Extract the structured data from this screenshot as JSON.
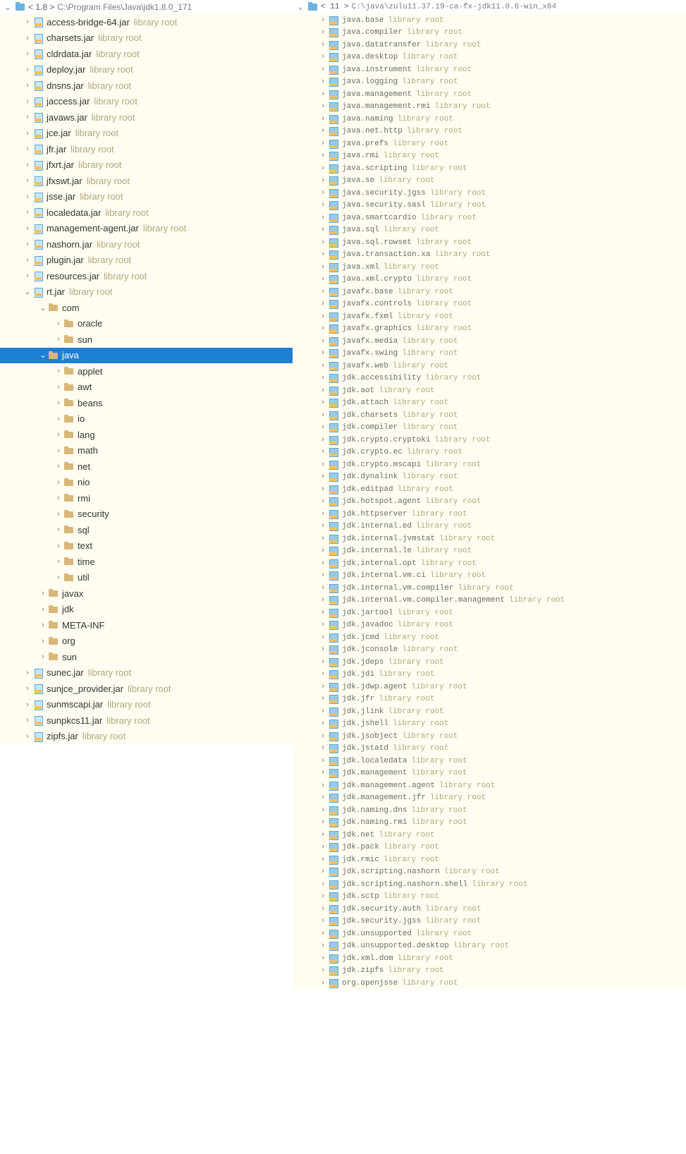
{
  "left": {
    "header": {
      "version": "< 1.8 >",
      "path": "C:\\Program Files\\Java\\jdk1.8.0_171"
    },
    "suffix": "library root",
    "nodes": [
      {
        "depth": 1,
        "arrow": "right",
        "icon": "jar",
        "name": "access-bridge-64.jar",
        "suffix": true
      },
      {
        "depth": 1,
        "arrow": "right",
        "icon": "jar",
        "name": "charsets.jar",
        "suffix": true
      },
      {
        "depth": 1,
        "arrow": "right",
        "icon": "jar",
        "name": "cldrdata.jar",
        "suffix": true
      },
      {
        "depth": 1,
        "arrow": "right",
        "icon": "jar",
        "name": "deploy.jar",
        "suffix": true
      },
      {
        "depth": 1,
        "arrow": "right",
        "icon": "jar",
        "name": "dnsns.jar",
        "suffix": true
      },
      {
        "depth": 1,
        "arrow": "right",
        "icon": "jar",
        "name": "jaccess.jar",
        "suffix": true
      },
      {
        "depth": 1,
        "arrow": "right",
        "icon": "jar",
        "name": "javaws.jar",
        "suffix": true
      },
      {
        "depth": 1,
        "arrow": "right",
        "icon": "jar",
        "name": "jce.jar",
        "suffix": true
      },
      {
        "depth": 1,
        "arrow": "right",
        "icon": "jar",
        "name": "jfr.jar",
        "suffix": true
      },
      {
        "depth": 1,
        "arrow": "right",
        "icon": "jar",
        "name": "jfxrt.jar",
        "suffix": true
      },
      {
        "depth": 1,
        "arrow": "right",
        "icon": "jar",
        "name": "jfxswt.jar",
        "suffix": true
      },
      {
        "depth": 1,
        "arrow": "right",
        "icon": "jar",
        "name": "jsse.jar",
        "suffix": true
      },
      {
        "depth": 1,
        "arrow": "right",
        "icon": "jar",
        "name": "localedata.jar",
        "suffix": true
      },
      {
        "depth": 1,
        "arrow": "right",
        "icon": "jar",
        "name": "management-agent.jar",
        "suffix": true
      },
      {
        "depth": 1,
        "arrow": "right",
        "icon": "jar",
        "name": "nashorn.jar",
        "suffix": true
      },
      {
        "depth": 1,
        "arrow": "right",
        "icon": "jar",
        "name": "plugin.jar",
        "suffix": true
      },
      {
        "depth": 1,
        "arrow": "right",
        "icon": "jar",
        "name": "resources.jar",
        "suffix": true
      },
      {
        "depth": 1,
        "arrow": "down",
        "icon": "jar",
        "name": "rt.jar",
        "suffix": true
      },
      {
        "depth": 2,
        "arrow": "down",
        "icon": "folder",
        "name": "com"
      },
      {
        "depth": 3,
        "arrow": "right",
        "icon": "folder",
        "name": "oracle"
      },
      {
        "depth": 3,
        "arrow": "right",
        "icon": "folder",
        "name": "sun"
      },
      {
        "depth": 2,
        "arrow": "down",
        "icon": "folder",
        "name": "java",
        "selected": true
      },
      {
        "depth": 3,
        "arrow": "right",
        "icon": "folder",
        "name": "applet"
      },
      {
        "depth": 3,
        "arrow": "right",
        "icon": "folder",
        "name": "awt"
      },
      {
        "depth": 3,
        "arrow": "right",
        "icon": "folder",
        "name": "beans"
      },
      {
        "depth": 3,
        "arrow": "right",
        "icon": "folder",
        "name": "io"
      },
      {
        "depth": 3,
        "arrow": "right",
        "icon": "folder",
        "name": "lang"
      },
      {
        "depth": 3,
        "arrow": "right",
        "icon": "folder",
        "name": "math"
      },
      {
        "depth": 3,
        "arrow": "right",
        "icon": "folder",
        "name": "net"
      },
      {
        "depth": 3,
        "arrow": "right",
        "icon": "folder",
        "name": "nio"
      },
      {
        "depth": 3,
        "arrow": "right",
        "icon": "folder",
        "name": "rmi"
      },
      {
        "depth": 3,
        "arrow": "right",
        "icon": "folder",
        "name": "security"
      },
      {
        "depth": 3,
        "arrow": "right",
        "icon": "folder",
        "name": "sql"
      },
      {
        "depth": 3,
        "arrow": "right",
        "icon": "folder",
        "name": "text"
      },
      {
        "depth": 3,
        "arrow": "right",
        "icon": "folder",
        "name": "time"
      },
      {
        "depth": 3,
        "arrow": "right",
        "icon": "folder",
        "name": "util"
      },
      {
        "depth": 2,
        "arrow": "right",
        "icon": "folder",
        "name": "javax"
      },
      {
        "depth": 2,
        "arrow": "right",
        "icon": "folder",
        "name": "jdk"
      },
      {
        "depth": 2,
        "arrow": "right",
        "icon": "folder",
        "name": "META-INF"
      },
      {
        "depth": 2,
        "arrow": "right",
        "icon": "folder",
        "name": "org"
      },
      {
        "depth": 2,
        "arrow": "right",
        "icon": "folder",
        "name": "sun"
      },
      {
        "depth": 1,
        "arrow": "right",
        "icon": "jar",
        "name": "sunec.jar",
        "suffix": true
      },
      {
        "depth": 1,
        "arrow": "right",
        "icon": "jar",
        "name": "sunjce_provider.jar",
        "suffix": true
      },
      {
        "depth": 1,
        "arrow": "right",
        "icon": "jar",
        "name": "sunmscapi.jar",
        "suffix": true
      },
      {
        "depth": 1,
        "arrow": "right",
        "icon": "jar",
        "name": "sunpkcs11.jar",
        "suffix": true
      },
      {
        "depth": 1,
        "arrow": "right",
        "icon": "jar",
        "name": "zipfs.jar",
        "suffix": true
      }
    ]
  },
  "right": {
    "header": {
      "version": "< 11 >",
      "path": "C:\\java\\zulu11.37.19-ca-fx-jdk11.0.6-win_x64"
    },
    "suffix": "library root",
    "nodes": [
      "java.base",
      "java.compiler",
      "java.datatransfer",
      "java.desktop",
      "java.instrument",
      "java.logging",
      "java.management",
      "java.management.rmi",
      "java.naming",
      "java.net.http",
      "java.prefs",
      "java.rmi",
      "java.scripting",
      "java.se",
      "java.security.jgss",
      "java.security.sasl",
      "java.smartcardio",
      "java.sql",
      "java.sql.rowset",
      "java.transaction.xa",
      "java.xml",
      "java.xml.crypto",
      "javafx.base",
      "javafx.controls",
      "javafx.fxml",
      "javafx.graphics",
      "javafx.media",
      "javafx.swing",
      "javafx.web",
      "jdk.accessibility",
      "jdk.aot",
      "jdk.attach",
      "jdk.charsets",
      "jdk.compiler",
      "jdk.crypto.cryptoki",
      "jdk.crypto.ec",
      "jdk.crypto.mscapi",
      "jdk.dynalink",
      "jdk.editpad",
      "jdk.hotspot.agent",
      "jdk.httpserver",
      "jdk.internal.ed",
      "jdk.internal.jvmstat",
      "jdk.internal.le",
      "jdk.internal.opt",
      "jdk.internal.vm.ci",
      "jdk.internal.vm.compiler",
      "jdk.internal.vm.compiler.management",
      "jdk.jartool",
      "jdk.javadoc",
      "jdk.jcmd",
      "jdk.jconsole",
      "jdk.jdeps",
      "jdk.jdi",
      "jdk.jdwp.agent",
      "jdk.jfr",
      "jdk.jlink",
      "jdk.jshell",
      "jdk.jsobject",
      "jdk.jstatd",
      "jdk.localedata",
      "jdk.management",
      "jdk.management.agent",
      "jdk.management.jfr",
      "jdk.naming.dns",
      "jdk.naming.rmi",
      "jdk.net",
      "jdk.pack",
      "jdk.rmic",
      "jdk.scripting.nashorn",
      "jdk.scripting.nashorn.shell",
      "jdk.sctp",
      "jdk.security.auth",
      "jdk.security.jgss",
      "jdk.unsupported",
      "jdk.unsupported.desktop",
      "jdk.xml.dom",
      "jdk.zipfs",
      "org.openjsse"
    ]
  },
  "glyph": {
    "right": "›",
    "down": "⌄"
  }
}
